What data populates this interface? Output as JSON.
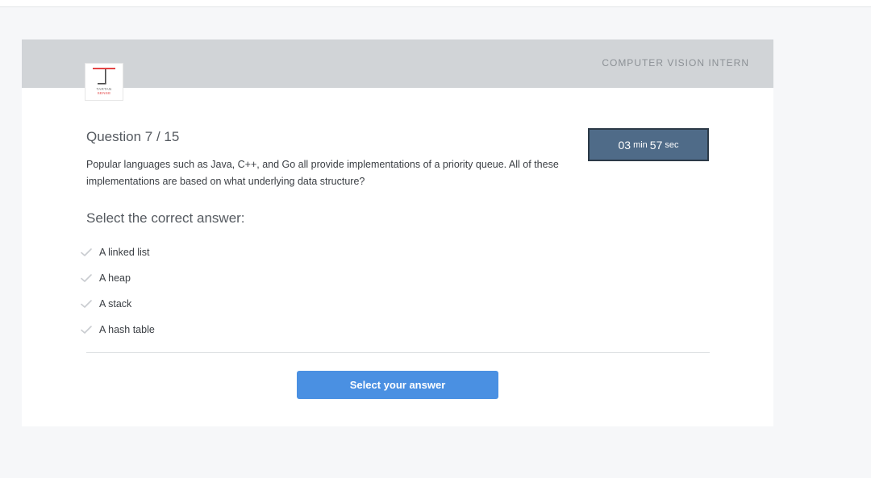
{
  "header": {
    "role_title": "COMPUTER VISION INTERN",
    "logo_line1": "TARTAN",
    "logo_line2": "SENSE"
  },
  "question": {
    "title": "Question 7 / 15",
    "text": "Popular languages such as Java, C++, and Go all provide implementations of a priority queue. All of these implementations are based on what underlying data structure?",
    "instruction": "Select the correct answer:"
  },
  "options": [
    {
      "label": "A linked list",
      "selected": false
    },
    {
      "label": "A heap",
      "selected": false
    },
    {
      "label": "A stack",
      "selected": false
    },
    {
      "label": "A hash table",
      "selected": false
    }
  ],
  "submit": {
    "label": "Select your answer",
    "color": "#4a90e2"
  },
  "timer": {
    "minutes": "03",
    "min_unit": "min",
    "seconds": "57",
    "sec_unit": "sec",
    "color": "#4f6b88"
  },
  "icons": {
    "option_marker": "check-icon",
    "logo": "tartan-sense-logo"
  }
}
